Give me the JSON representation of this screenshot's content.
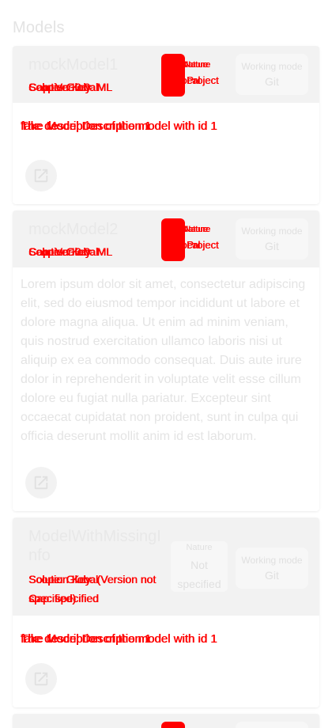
{
  "section": {
    "title": "Models"
  },
  "cards": [
    {
      "title": "mockModel1",
      "subtitle_layers": [
        "Solution Key: ML",
        "Scope: Global",
        "Cap: Ver 3.0"
      ],
      "nature": {
        "label": "Nature",
        "value_layers": [
          "Project",
          "Local"
        ]
      },
      "working_mode": {
        "label": "Working mode",
        "value": "Git"
      },
      "description_layers": [
        "The description of the model with id 1",
        "fake Model Description 1"
      ]
    },
    {
      "title": "mockModel2",
      "subtitle_layers": [
        "Solution Key: ML",
        "Scope: Global",
        "Cap: Ver 3.0"
      ],
      "nature": {
        "label": "Nature",
        "value_layers": [
          "Project",
          "Local"
        ]
      },
      "working_mode": {
        "label": "Working mode",
        "value": "Git"
      },
      "description": "Lorem ipsum dolor sit amet, consectetur adipiscing elit, sed do eiusmod tempor incididunt ut labore et dolore magna aliqua. Ut enim ad minim veniam, quis nostrud exercitation ullamco laboris nisi ut aliquip ex ea commodo consequat. Duis aute irure dolor in reprehenderit in voluptate velit esse cillum dolore eu fugiat nulla pariatur. Excepteur sint occaecat cupidatat non proident, sunt in culpa qui officia deserunt mollit anim id est laborum."
    },
    {
      "title": "ModelWithMissingInfo",
      "subtitle_layers": [
        "Solution Key: (Version not specified)",
        "Scope: Global",
        "Cap: specified"
      ],
      "nature": {
        "label": "Nature",
        "value": "Not specified"
      },
      "working_mode": {
        "label": "Working mode",
        "value": "Git"
      },
      "description_layers": [
        "The description of the model with id 1",
        "fake Model Description 1"
      ]
    }
  ],
  "icons": {
    "open": "open-in-new-icon"
  },
  "colors": {
    "accent": "#ff0000",
    "header_bg": "#f2f2f2"
  }
}
